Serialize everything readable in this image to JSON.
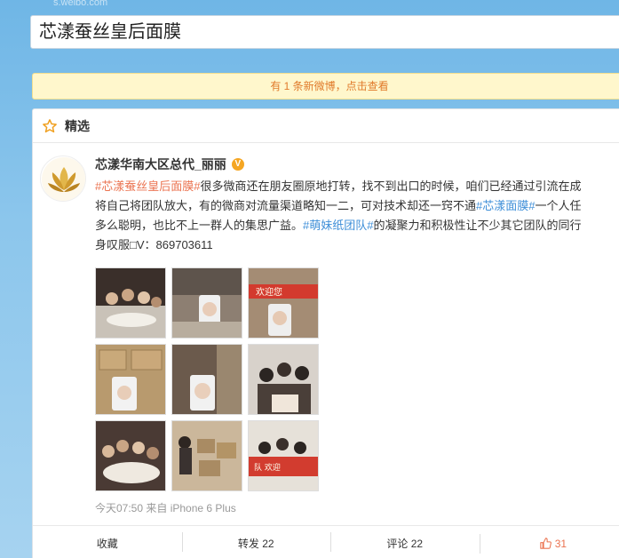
{
  "topstrip": {
    "url_fragment": "s.weibo.com"
  },
  "search": {
    "query": "芯漾蚕丝皇后面膜"
  },
  "notice": {
    "text": "有 1 条新微博，点击查看"
  },
  "card": {
    "title": "精选"
  },
  "post": {
    "author": "芯漾华南大区总代_丽丽",
    "lines": [
      {
        "tag1": "#芯漾蚕丝皇后面膜#",
        "text1": "很多微商还在朋友圈原地打转，找不到出口的时候，咱们已经通过引流在成"
      },
      {
        "text1": "将自己将团队放大，有的微商对流量渠道略知一二，可对技术却还一窍不通",
        "tag1": "#芯漾面膜#",
        "text2": "一个人任"
      },
      {
        "text1": "多么聪明，也比不上一群人的集思广益。",
        "tag1": "#萌妹纸团队#",
        "text2": "的凝聚力和积极性让不少其它团队的同行"
      },
      {
        "text1": "身叹服□V：869703611"
      }
    ],
    "image_count": 9,
    "time": "今天07:50 来自 iPhone 6 Plus"
  },
  "actions": {
    "favorite": "收藏",
    "repost": "转发 22",
    "comment": "评论 22",
    "like": "31"
  }
}
